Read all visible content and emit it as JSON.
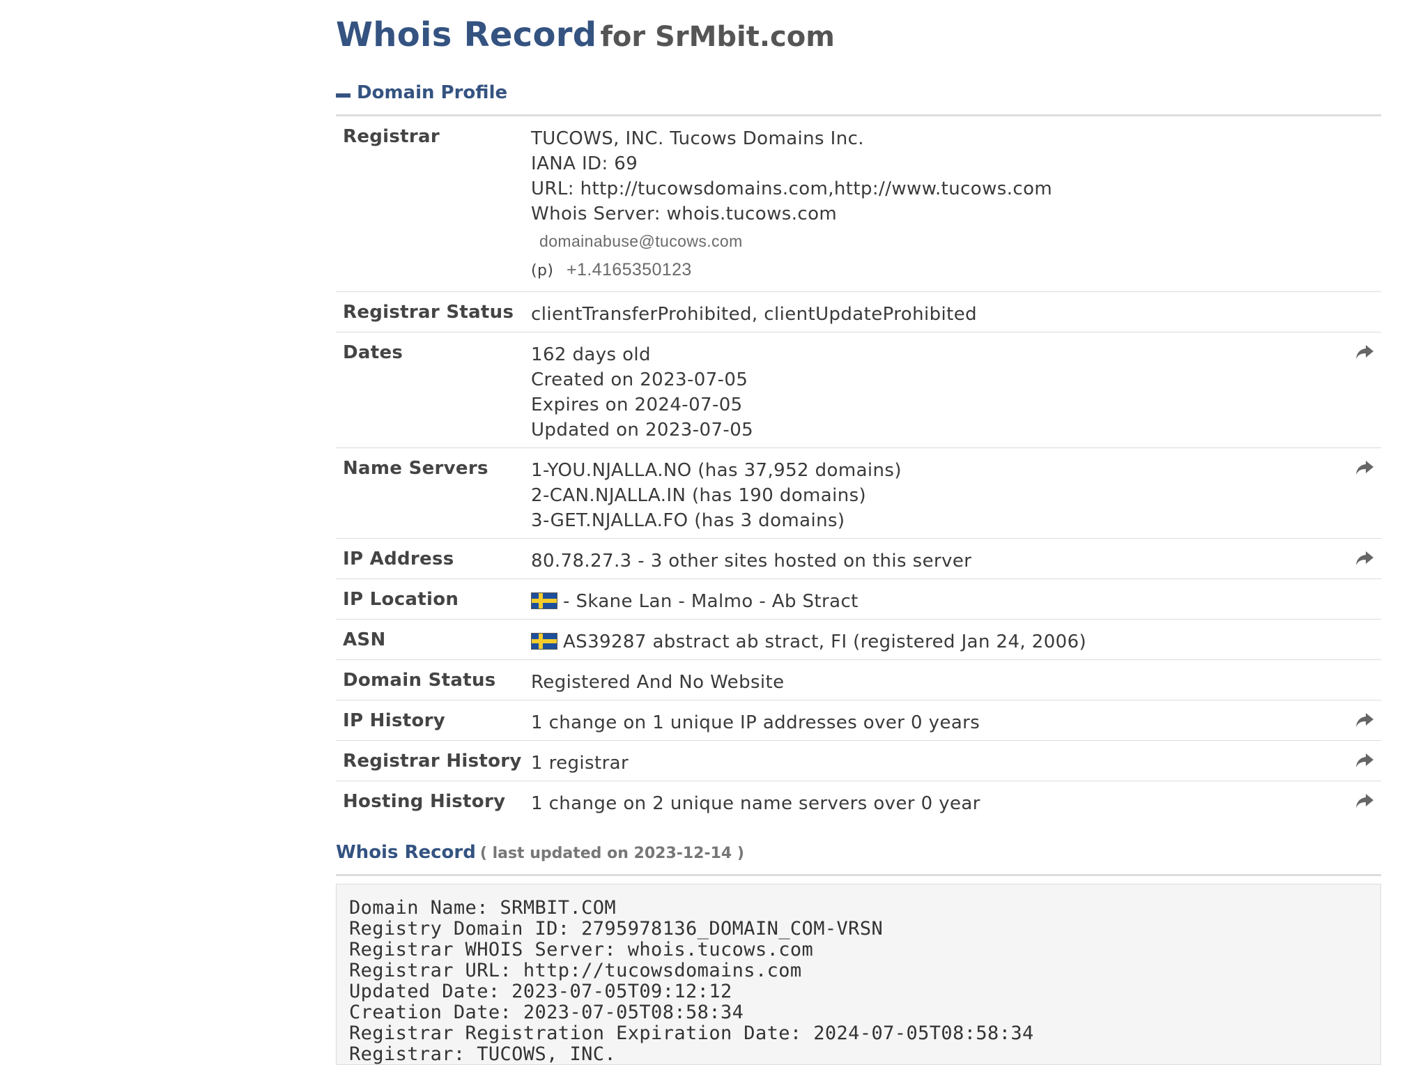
{
  "header": {
    "title_main": "Whois Record",
    "title_sub": "for SrMbit.com"
  },
  "profile": {
    "section_title": "Domain Profile",
    "registrar": {
      "label": "Registrar",
      "name": "TUCOWS, INC. Tucows Domains Inc.",
      "iana": "IANA ID: 69",
      "url": "URL: http://tucowsdomains.com,http://www.tucows.com",
      "whois_server": "Whois Server: whois.tucows.com",
      "email": "domainabuse@tucows.com",
      "phone_prefix": "(p)",
      "phone": "+1.4165350123"
    },
    "registrar_status": {
      "label": "Registrar Status",
      "value": "clientTransferProhibited, clientUpdateProhibited"
    },
    "dates": {
      "label": "Dates",
      "age": "162 days old",
      "created": "Created on 2023-07-05",
      "expires": "Expires on 2024-07-05",
      "updated": "Updated on 2023-07-05"
    },
    "name_servers": {
      "label": "Name Servers",
      "items": [
        "1-YOU.NJALLA.NO (has 37,952 domains)",
        "2-CAN.NJALLA.IN (has 190 domains)",
        "3-GET.NJALLA.FO (has 3 domains)"
      ]
    },
    "ip_address": {
      "label": "IP Address",
      "value": "80.78.27.3 - 3 other sites hosted on this server"
    },
    "ip_location": {
      "label": "IP Location",
      "value": "- Skane Lan - Malmo - Ab Stract"
    },
    "asn": {
      "label": "ASN",
      "value": "AS39287 abstract ab stract, FI (registered Jan 24, 2006)"
    },
    "domain_status": {
      "label": "Domain Status",
      "value": "Registered And No Website"
    },
    "ip_history": {
      "label": "IP History",
      "value": "1 change on 1 unique IP addresses over 0 years"
    },
    "registrar_history": {
      "label": "Registrar History",
      "value": "1 registrar"
    },
    "hosting_history": {
      "label": "Hosting History",
      "value": "1 change on 2 unique name servers over 0 year"
    }
  },
  "whois_record": {
    "title": "Whois Record",
    "updated": "( last updated on 2023-12-14 )",
    "lines": [
      "Domain Name: SRMBIT.COM",
      "Registry Domain ID: 2795978136_DOMAIN_COM-VRSN",
      "Registrar WHOIS Server: whois.tucows.com",
      "Registrar URL: http://tucowsdomains.com",
      "Updated Date: 2023-07-05T09:12:12",
      "Creation Date: 2023-07-05T08:58:34",
      "Registrar Registration Expiration Date: 2024-07-05T08:58:34",
      "Registrar: TUCOWS, INC."
    ]
  },
  "icons": {
    "share": "share-arrow-icon",
    "collapse": "minus-icon",
    "flag": "sweden-flag-icon"
  },
  "colors": {
    "accent": "#345381",
    "border": "#dddddd",
    "raw_bg": "#f5f5f5"
  }
}
